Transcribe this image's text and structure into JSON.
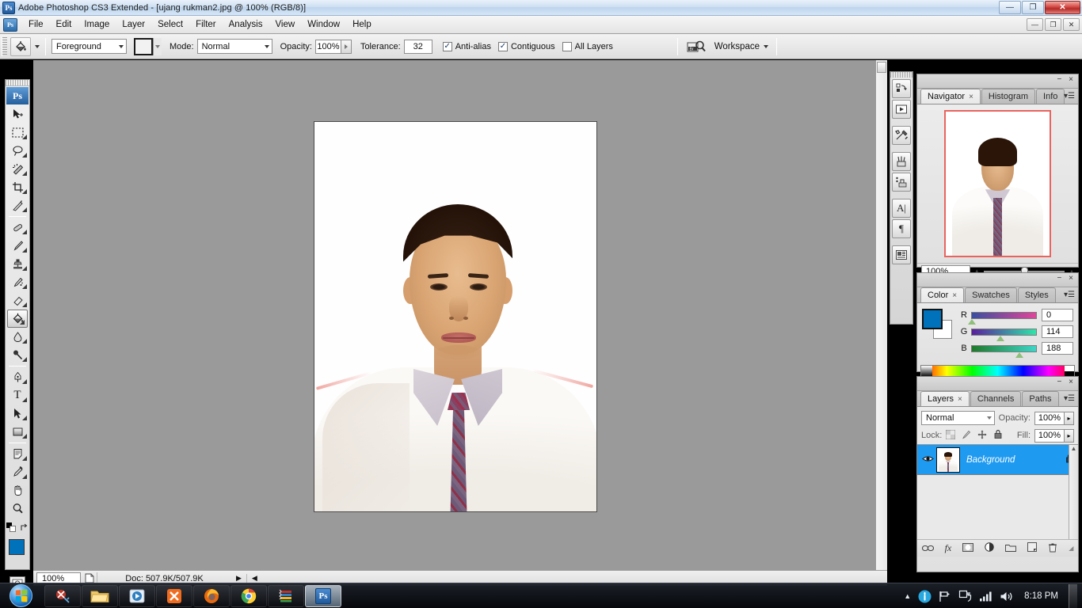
{
  "window": {
    "app_title": "Adobe Photoshop CS3 Extended - [ujang rukman2.jpg @ 100% (RGB/8)]",
    "app_icon": "Ps",
    "minimize": "—",
    "restore": "❐",
    "close": "✕"
  },
  "menubar": {
    "app_icon": "Ps",
    "items": [
      {
        "label": "File"
      },
      {
        "label": "Edit"
      },
      {
        "label": "Image"
      },
      {
        "label": "Layer"
      },
      {
        "label": "Select"
      },
      {
        "label": "Filter"
      },
      {
        "label": "Analysis"
      },
      {
        "label": "View"
      },
      {
        "label": "Window"
      },
      {
        "label": "Help"
      }
    ],
    "doc_minimize": "—",
    "doc_restore": "❐",
    "doc_close": "✕"
  },
  "options_bar": {
    "tool_icon": "paint-bucket",
    "fill_source": "Foreground",
    "mode_label": "Mode:",
    "mode_value": "Normal",
    "opacity_label": "Opacity:",
    "opacity_value": "100%",
    "tolerance_label": "Tolerance:",
    "tolerance_value": "32",
    "antialias_label": "Anti-alias",
    "antialias_checked": true,
    "contiguous_label": "Contiguous",
    "contiguous_checked": true,
    "all_layers_label": "All Layers",
    "all_layers_checked": false,
    "bridge_icon": "Br",
    "workspace_label": "Workspace"
  },
  "toolbox": {
    "logo": "Ps",
    "tools": [
      {
        "name": "move-tool",
        "glyph": "↖"
      },
      {
        "name": "marquee-tool",
        "glyph": "⬚"
      },
      {
        "name": "lasso-tool",
        "glyph": "⌀"
      },
      {
        "name": "magic-wand-tool",
        "glyph": "✦"
      },
      {
        "name": "crop-tool",
        "glyph": "⛶"
      },
      {
        "name": "slice-tool",
        "glyph": "✁"
      },
      {
        "name": "healing-brush-tool",
        "glyph": "✎"
      },
      {
        "name": "brush-tool",
        "glyph": "✒"
      },
      {
        "name": "clone-stamp-tool",
        "glyph": "⚓"
      },
      {
        "name": "history-brush-tool",
        "glyph": "❃"
      },
      {
        "name": "eraser-tool",
        "glyph": "▱"
      },
      {
        "name": "paint-bucket-tool",
        "glyph": "◠",
        "selected": true
      },
      {
        "name": "gradient-blur-tool",
        "glyph": "●"
      },
      {
        "name": "dodge-tool",
        "glyph": "⚲"
      },
      {
        "name": "pen-tool",
        "glyph": "✐"
      },
      {
        "name": "type-tool",
        "glyph": "T"
      },
      {
        "name": "path-selection-tool",
        "glyph": "➤"
      },
      {
        "name": "shape-tool",
        "glyph": "■"
      },
      {
        "name": "notes-tool",
        "glyph": "☰"
      },
      {
        "name": "eyedropper-tool",
        "glyph": "⚗"
      },
      {
        "name": "hand-tool",
        "glyph": "✋"
      },
      {
        "name": "zoom-tool",
        "glyph": "⌕"
      }
    ],
    "foreground_color": "#0072BC",
    "background_color": "#FFFFFF",
    "quickmask_standard": "□",
    "quickmask_mask": "▣",
    "screenmode": "❒"
  },
  "document": {
    "file_name": "ujang rukman2.jpg",
    "zoom": "100%",
    "color_mode": "RGB/8"
  },
  "status_bar": {
    "zoom": "100%",
    "doc_icon": "page-icon",
    "doc_info": "Doc: 507.9K/507.9K",
    "expand_arrow": "▶",
    "left_arrow": "◀"
  },
  "icon_dock": {
    "buttons": [
      {
        "name": "history-panel-icon",
        "glyph": "↺"
      },
      {
        "name": "actions-panel-icon",
        "glyph": "▶"
      },
      {
        "name": "tool-presets-panel-icon",
        "glyph": "⚒"
      },
      {
        "name": "brushes-panel-icon",
        "glyph": "❀"
      },
      {
        "name": "clone-source-panel-icon",
        "glyph": "⚙"
      },
      {
        "name": "character-panel-icon",
        "glyph": "A"
      },
      {
        "name": "paragraph-panel-icon",
        "glyph": "¶"
      },
      {
        "name": "layer-comps-panel-icon",
        "glyph": "▤"
      }
    ]
  },
  "navigator_panel": {
    "tabs": [
      {
        "label": "Navigator",
        "active": true,
        "closable": true
      },
      {
        "label": "Histogram",
        "active": false,
        "closable": false
      },
      {
        "label": "Info",
        "active": false,
        "closable": false
      }
    ],
    "zoom_value": "100%",
    "zoom_out_icon": "small-mountain-icon",
    "zoom_in_icon": "large-mountain-icon",
    "menu_icon": "panel-menu-icon",
    "view_box_color": "#E8645F"
  },
  "color_panel": {
    "tabs": [
      {
        "label": "Color",
        "active": true,
        "closable": true
      },
      {
        "label": "Swatches",
        "active": false,
        "closable": false
      },
      {
        "label": "Styles",
        "active": false,
        "closable": false
      }
    ],
    "foreground": "#0072BC",
    "background": "#FFFFFF",
    "channels": [
      {
        "label": "R",
        "value": "0",
        "pct": 0
      },
      {
        "label": "G",
        "value": "114",
        "pct": 45
      },
      {
        "label": "B",
        "value": "188",
        "pct": 74
      }
    ]
  },
  "layers_panel": {
    "tabs": [
      {
        "label": "Layers",
        "active": true,
        "closable": true
      },
      {
        "label": "Channels",
        "active": false,
        "closable": false
      },
      {
        "label": "Paths",
        "active": false,
        "closable": false
      }
    ],
    "blend_mode": "Normal",
    "opacity_label": "Opacity:",
    "opacity_value": "100%",
    "lock_label": "Lock:",
    "lock_icons": [
      {
        "name": "lock-transparent-icon",
        "glyph": "▨"
      },
      {
        "name": "lock-image-icon",
        "glyph": "✐"
      },
      {
        "name": "lock-position-icon",
        "glyph": "✛"
      },
      {
        "name": "lock-all-icon",
        "glyph": "ὑ2"
      }
    ],
    "fill_label": "Fill:",
    "fill_value": "100%",
    "layers": [
      {
        "name": "Background",
        "visible": true,
        "locked": true,
        "selected": true
      }
    ],
    "footer_buttons": [
      {
        "name": "link-layers-button",
        "glyph": "⚭"
      },
      {
        "name": "layer-style-button",
        "glyph": "ƒx"
      },
      {
        "name": "layer-mask-button",
        "glyph": "□"
      },
      {
        "name": "adjustment-layer-button",
        "glyph": "◑"
      },
      {
        "name": "new-group-button",
        "glyph": "▱"
      },
      {
        "name": "new-layer-button",
        "glyph": "◳"
      },
      {
        "name": "delete-layer-button",
        "glyph": "⌫"
      }
    ]
  },
  "taskbar": {
    "start_label": "Start",
    "items": [
      {
        "name": "taskbar-item-antivirus",
        "glyph": "⛔",
        "active": false
      },
      {
        "name": "taskbar-item-explorer",
        "glyph": "🗁",
        "active": false
      },
      {
        "name": "taskbar-item-media-player",
        "glyph": "▶",
        "active": false
      },
      {
        "name": "taskbar-item-xampp",
        "glyph": "✕",
        "active": false
      },
      {
        "name": "taskbar-item-firefox",
        "glyph": "●",
        "active": false
      },
      {
        "name": "taskbar-item-chrome",
        "glyph": "◉",
        "active": false
      },
      {
        "name": "taskbar-item-winrar",
        "glyph": "☰",
        "active": false
      },
      {
        "name": "taskbar-item-photoshop",
        "glyph": "Ps",
        "active": true
      }
    ],
    "tray": [
      {
        "name": "show-hidden-icons-icon",
        "glyph": "▲"
      },
      {
        "name": "action-center-icon",
        "glyph": "i"
      },
      {
        "name": "network-flag-icon",
        "glyph": "⚑"
      },
      {
        "name": "network-connection-icon",
        "glyph": "⌨"
      },
      {
        "name": "signal-bars-icon",
        "glyph": "▂▄▆"
      },
      {
        "name": "volume-icon",
        "glyph": "🔊"
      }
    ],
    "clock": "8:18 PM"
  }
}
